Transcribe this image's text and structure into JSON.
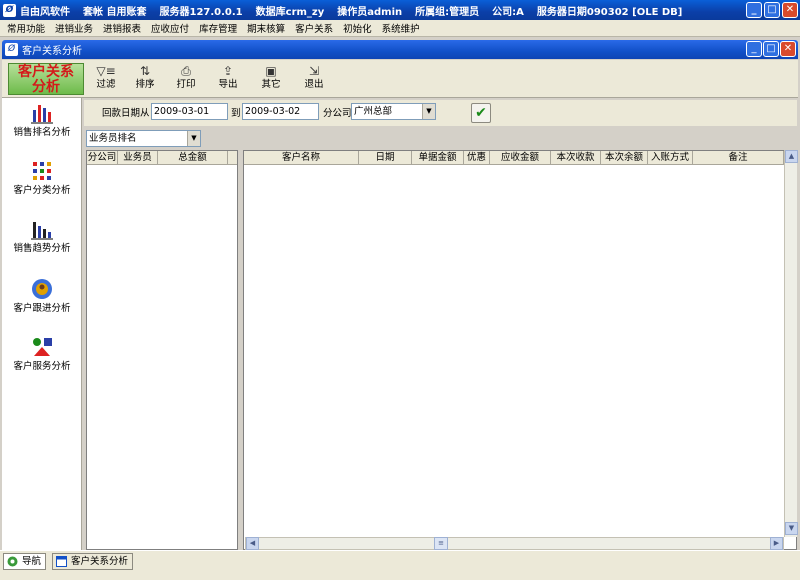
{
  "app_title_segments": [
    "自由风软件",
    "套帐 自用账套",
    "服务器127.0.0.1",
    "数据库crm_zy",
    "操作员admin",
    "所属组:管理员",
    "公司:A",
    "服务器日期090302 [OLE DB]"
  ],
  "menu": [
    "常用功能",
    "进销业务",
    "进销报表",
    "应收应付",
    "库存管理",
    "期末核算",
    "客户关系",
    "初始化",
    "系统维护"
  ],
  "window_title": "客户关系分析",
  "banner_lines": [
    "客户关系",
    "分析"
  ],
  "toolbar": [
    {
      "icon": "filter-icon",
      "label": "过滤"
    },
    {
      "icon": "sort-icon",
      "label": "排序"
    },
    {
      "icon": "printer-icon",
      "label": "打印"
    },
    {
      "icon": "export-icon",
      "label": "导出"
    },
    {
      "icon": "other-icon",
      "label": "其它"
    },
    {
      "icon": "exit-icon",
      "label": "退出"
    }
  ],
  "nav": [
    {
      "icon": "bar-chart-icon",
      "label": "销售排名分析"
    },
    {
      "icon": "grid-dots-icon",
      "label": "客户分类分析"
    },
    {
      "icon": "trend-chart-icon",
      "label": "销售趋势分析"
    },
    {
      "icon": "globe-person-icon",
      "label": "客户跟进分析"
    },
    {
      "icon": "shapes-icon",
      "label": "客户服务分析"
    }
  ],
  "filter": {
    "date_label": "回款日期从",
    "date_from": "2009-03-01",
    "to_label": "到",
    "date_to": "2009-03-02",
    "branch_label": "分公司",
    "branch_value": "广州总部"
  },
  "ranking_select": "业务员排名",
  "left_grid_columns": [
    "分公司",
    "业务员",
    "总金额"
  ],
  "right_grid_columns": [
    "客户名称",
    "日期",
    "单据金额",
    "优惠",
    "应收金额",
    "本次收款",
    "本次余额",
    "入账方式",
    "备注"
  ],
  "taskbar": [
    {
      "icon": "nav-icon",
      "label": "导航"
    },
    {
      "icon": "window-icon",
      "label": "客户关系分析"
    }
  ],
  "colors": {
    "title_bar": "#0b3fa8",
    "banner_text": "#d41a1a",
    "banner_bg": "#6dbb4a",
    "confirm_check": "#1a8a1a"
  }
}
